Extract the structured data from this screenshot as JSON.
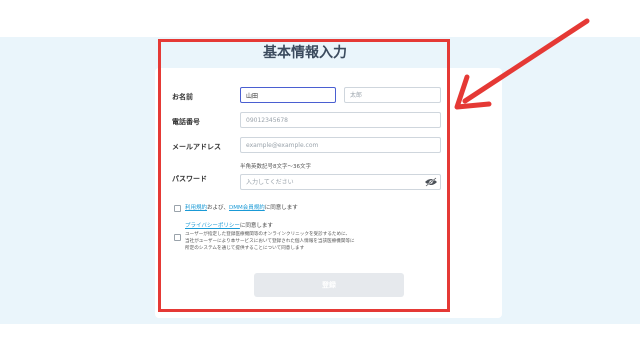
{
  "form": {
    "title": "基本情報入力",
    "name_label": "お名前",
    "last_name_value": "山田",
    "first_name_placeholder": "太郎",
    "phone_label": "電話番号",
    "phone_placeholder": "09012345678",
    "email_label": "メールアドレス",
    "email_placeholder": "example@example.com",
    "password_label": "パスワード",
    "password_hint": "半角英数記号8文字〜36文字",
    "password_placeholder": "入力してください",
    "terms_link1": "利用規約",
    "terms_mid": "および、",
    "terms_link2": "DMM会員規約",
    "terms_end": "に同意します",
    "privacy_link": "プライバシーポリシー",
    "privacy_end": "に同意します",
    "consent_line1": "ユーザーが指定した登録医療機関等のオンラインクリニックを受診するために、",
    "consent_line2": "当社がユーザーにより本サービスにおいて登録された個人情報を当該医療機関等に",
    "consent_line3": "所定のシステムを通じて提供することについて同意します",
    "submit_label": "登録"
  },
  "colors": {
    "highlight": "#e53935",
    "link": "#1a9ad6",
    "background_band": "#eaf5fb"
  }
}
